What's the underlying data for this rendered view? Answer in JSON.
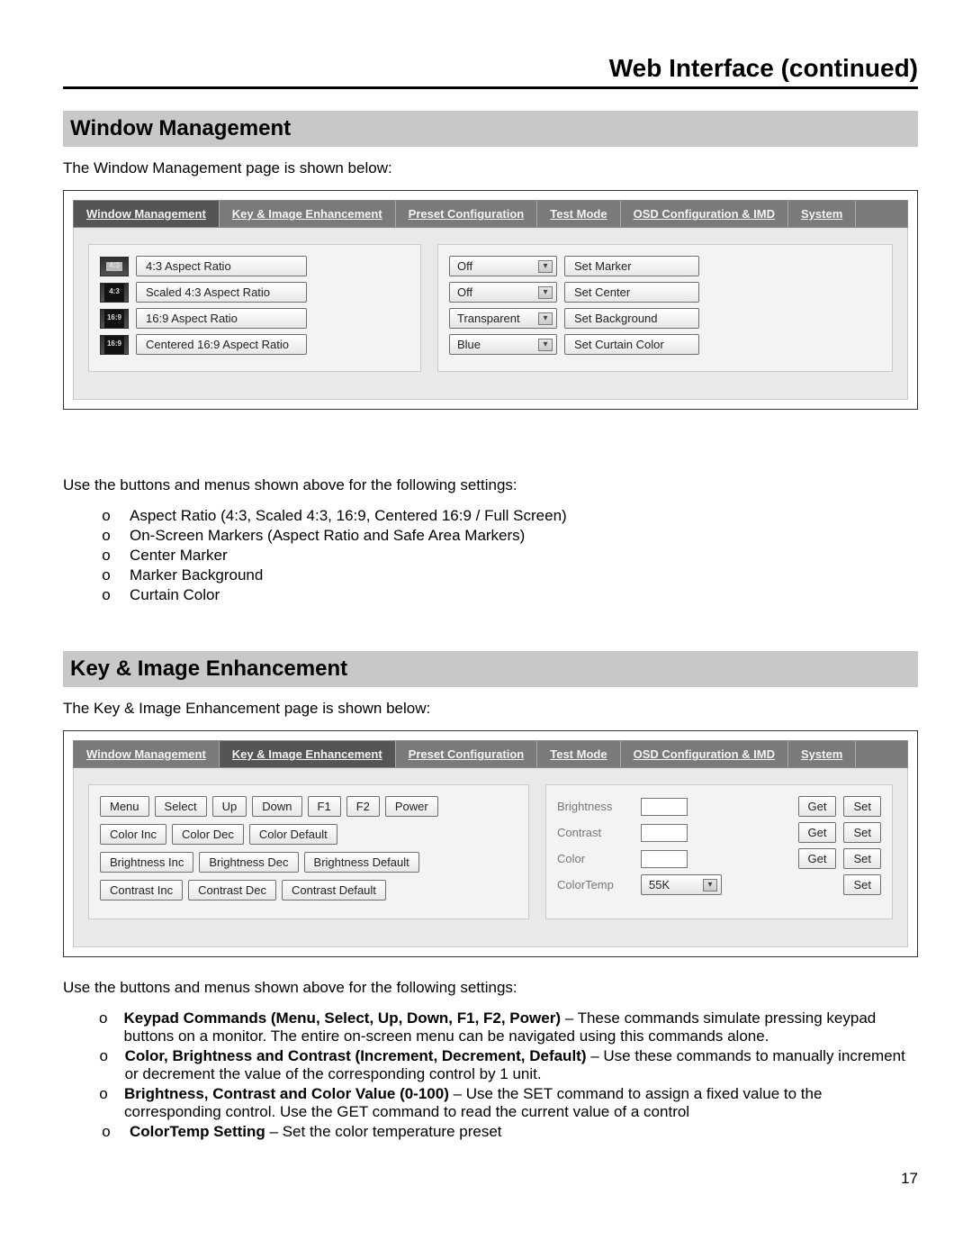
{
  "page_title": "Web Interface (continued)",
  "page_number": "17",
  "sections": {
    "wm": {
      "header": "Window Management",
      "intro": "The Window Management page is shown below:",
      "use_text": "Use the buttons and menus shown above for the following settings:",
      "bullets": [
        "Aspect Ratio (4:3, Scaled 4:3, 16:9, Centered 16:9 / Full Screen)",
        "On-Screen Markers (Aspect Ratio and Safe Area Markers)",
        "Center Marker",
        "Marker Background",
        "Curtain Color"
      ]
    },
    "kie": {
      "header": "Key & Image Enhancement",
      "intro": "The Key & Image Enhancement page is shown below:",
      "use_text": "Use the buttons and menus shown above for the following settings:",
      "bullets": [
        {
          "bold": "Keypad Commands (Menu, Select, Up, Down, F1, F2, Power)",
          "rest": " – These commands simulate pressing keypad buttons on a monitor. The entire on-screen menu can be navigated using this commands alone."
        },
        {
          "bold": "Color, Brightness and Contrast (Increment, Decrement, Default)",
          "rest": " – Use these commands to manually increment or decrement the value of the corresponding control by 1 unit."
        },
        {
          "bold": "Brightness, Contrast and Color Value (0-100)",
          "rest": " – Use the SET command to assign a fixed value to the corresponding control. Use the GET command to read the current value of a control"
        },
        {
          "bold": "ColorTemp Setting",
          "rest": " – Set the color temperature preset"
        }
      ]
    }
  },
  "navtabs": {
    "wm": "Window Management",
    "kie": "Key & Image Enhancement",
    "preset": "Preset Configuration",
    "test": "Test Mode",
    "osd": "OSD Configuration & IMD",
    "system": "System"
  },
  "wm_panel": {
    "aspect": {
      "a43": "4:3 Aspect Ratio",
      "s43": "Scaled 4:3 Aspect Ratio",
      "a169": "16:9 Aspect Ratio",
      "c169": "Centered 16:9 Aspect Ratio",
      "badge43": "4:3",
      "badge169": "16:9"
    },
    "right": {
      "marker_sel": "Off",
      "marker_btn": "Set Marker",
      "center_sel": "Off",
      "center_btn": "Set Center",
      "bg_sel": "Transparent",
      "bg_btn": "Set Background",
      "curtain_sel": "Blue",
      "curtain_btn": "Set Curtain Color"
    }
  },
  "kie_panel": {
    "keys": {
      "menu": "Menu",
      "select": "Select",
      "up": "Up",
      "down": "Down",
      "f1": "F1",
      "f2": "F2",
      "power": "Power",
      "color_inc": "Color Inc",
      "color_dec": "Color Dec",
      "color_def": "Color Default",
      "bri_inc": "Brightness Inc",
      "bri_dec": "Brightness Dec",
      "bri_def": "Brightness Default",
      "con_inc": "Contrast Inc",
      "con_dec": "Contrast Dec",
      "con_def": "Contrast Default"
    },
    "labels": {
      "brightness": "Brightness",
      "contrast": "Contrast",
      "color": "Color",
      "colortemp": "ColorTemp"
    },
    "get": "Get",
    "set": "Set",
    "colortemp_value": "55K"
  }
}
